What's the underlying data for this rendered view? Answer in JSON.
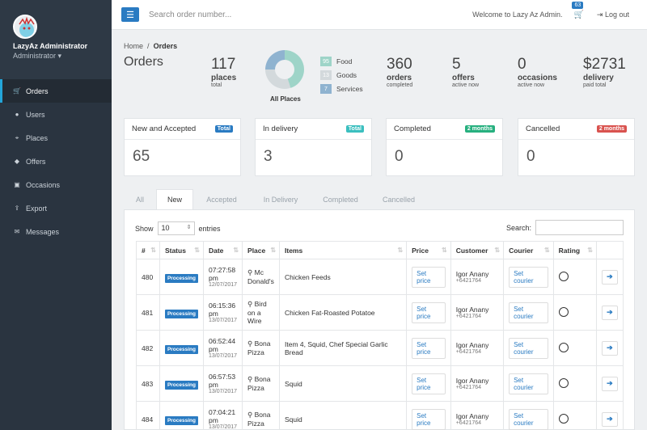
{
  "sidebar": {
    "user_name": "LazyAz Administrator",
    "user_role": "Administrator",
    "menu": [
      {
        "label": "Orders",
        "icon": "cart-icon",
        "glyph": "🛒"
      },
      {
        "label": "Users",
        "icon": "user-icon",
        "glyph": "●"
      },
      {
        "label": "Places",
        "icon": "map-marker-icon",
        "glyph": "⌖"
      },
      {
        "label": "Offers",
        "icon": "tag-icon",
        "glyph": "◆"
      },
      {
        "label": "Occasions",
        "icon": "gift-icon",
        "glyph": "▣"
      },
      {
        "label": "Export",
        "icon": "upload-icon",
        "glyph": "⇪"
      },
      {
        "label": "Messages",
        "icon": "envelope-icon",
        "glyph": "✉"
      }
    ]
  },
  "topbar": {
    "search_placeholder": "Search order number...",
    "welcome": "Welcome to Lazy Az Admin.",
    "cart_count": "63",
    "logout": "Log out"
  },
  "breadcrumb": {
    "home": "Home",
    "sep": "/",
    "current": "Orders"
  },
  "page_title": "Orders",
  "stats": {
    "places": {
      "num": "117",
      "label": "places",
      "sub": "total"
    },
    "orders": {
      "num": "360",
      "label": "orders",
      "sub": "completed"
    },
    "offers": {
      "num": "5",
      "label": "offers",
      "sub": "active now"
    },
    "occasions": {
      "num": "0",
      "label": "occasions",
      "sub": "active now"
    },
    "delivery": {
      "num": "$2731",
      "label": "delivery",
      "sub": "paid total"
    }
  },
  "donut": {
    "label": "All Places",
    "legend": [
      {
        "count": "95",
        "label": "Food",
        "color": "#9ed4c8"
      },
      {
        "count": "13",
        "label": "Goods",
        "color": "#d3d9dc"
      },
      {
        "count": "7",
        "label": "Services",
        "color": "#8fb3d0"
      }
    ]
  },
  "cards": [
    {
      "title": "New and Accepted",
      "tag": "Total",
      "tag_color": "#2a7bc2",
      "value": "65"
    },
    {
      "title": "In delivery",
      "tag": "Total",
      "tag_color": "#3bbfbf",
      "value": "3"
    },
    {
      "title": "Completed",
      "tag": "2 months",
      "tag_color": "#27b07f",
      "value": "0"
    },
    {
      "title": "Cancelled",
      "tag": "2 months",
      "tag_color": "#d9534f",
      "value": "0"
    }
  ],
  "tabs": [
    "All",
    "New",
    "Accepted",
    "In Delivery",
    "Completed",
    "Cancelled"
  ],
  "table": {
    "show_label": "Show",
    "entries_value": "10",
    "entries_label": "entries",
    "search_label": "Search:",
    "columns": [
      "#",
      "Status",
      "Date",
      "Place",
      "Items",
      "Price",
      "Customer",
      "Courier",
      "Rating",
      ""
    ],
    "rows": [
      {
        "id": "480",
        "status": "Processing",
        "time": "07:27:58 pm",
        "date": "12/07/2017",
        "place": "Mc Donald's",
        "items": "Chicken Feeds",
        "price": "Set price",
        "customer": "Igor Anany",
        "phone": "+6421764",
        "courier": "Set courier"
      },
      {
        "id": "481",
        "status": "Processing",
        "time": "06:15:36 pm",
        "date": "13/07/2017",
        "place": "Bird on a Wire",
        "items": "Chicken Fat-Roasted Potatoe",
        "price": "Set price",
        "customer": "Igor Anany",
        "phone": "+6421764",
        "courier": "Set courier"
      },
      {
        "id": "482",
        "status": "Processing",
        "time": "06:52:44 pm",
        "date": "13/07/2017",
        "place": "Bona Pizza",
        "items": "Item 4, Squid, Chef Special Garlic Bread",
        "price": "Set price",
        "customer": "Igor Anany",
        "phone": "+6421764",
        "courier": "Set courier"
      },
      {
        "id": "483",
        "status": "Processing",
        "time": "06:57:53 pm",
        "date": "13/07/2017",
        "place": "Bona Pizza",
        "items": "Squid",
        "price": "Set price",
        "customer": "Igor Anany",
        "phone": "+6421764",
        "courier": "Set courier"
      },
      {
        "id": "484",
        "status": "Processing",
        "time": "07:04:21 pm",
        "date": "13/07/2017",
        "place": "Bona Pizza",
        "items": "Squid",
        "price": "Set price",
        "customer": "Igor Anany",
        "phone": "+6421764",
        "courier": "Set courier"
      }
    ]
  }
}
